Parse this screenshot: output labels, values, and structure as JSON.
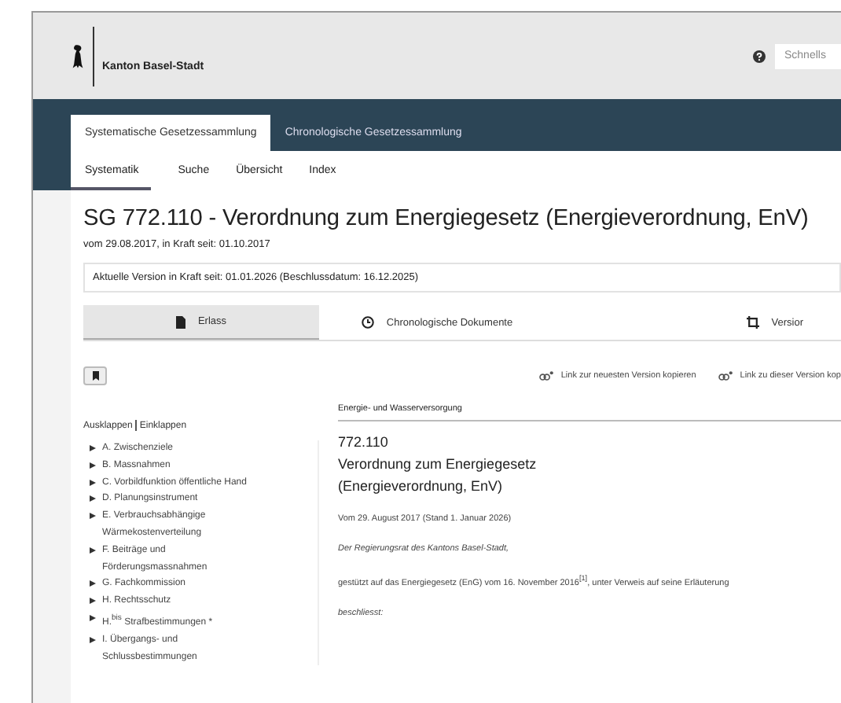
{
  "header": {
    "brand": "Kanton Basel-Stadt",
    "search": {
      "placeholder": "Schnells"
    }
  },
  "nav": {
    "tabs": [
      {
        "label": "Systematische Gesetzessammlung",
        "selected": true
      },
      {
        "label": "Chronologische Gesetzessammlung",
        "selected": false
      }
    ],
    "subtabs": [
      {
        "label": "Systematik",
        "selected": true
      },
      {
        "label": "Suche",
        "selected": false
      },
      {
        "label": "Übersicht",
        "selected": false
      },
      {
        "label": "Index",
        "selected": false
      }
    ]
  },
  "document": {
    "title": "SG 772.110 - Verordnung zum Energiegesetz (Energieverordnung, EnV)",
    "subtitle": "vom 29.08.2017, in Kraft seit: 01.10.2017",
    "version_info": "Aktuelle Version in Kraft seit: 01.01.2026 (Beschlussdatum: 16.12.2025)",
    "view_tabs": [
      {
        "label": "Erlass",
        "kind": "document",
        "selected": true
      },
      {
        "label": "Chronologische Dokumente",
        "kind": "clock",
        "selected": false
      },
      {
        "label": "Versior",
        "kind": "crop",
        "selected": false
      }
    ]
  },
  "links": [
    "Link zur neuesten Version kopieren",
    "Link zu dieser Version kop"
  ],
  "sidebar": {
    "toggle": [
      "Ausklappen",
      "Einklappen"
    ],
    "items": [
      {
        "label": "A. Zwischenziele",
        "expanded": false
      },
      {
        "label": "B. Massnahmen",
        "expanded": false
      },
      {
        "label": "C. Vorbildfunktion öffentliche Hand",
        "expanded": false
      },
      {
        "label": "D. Planungsinstrument",
        "expanded": false
      },
      {
        "label": "E. Verbrauchsabhängige Wärmekostenverteilung",
        "expanded": false
      },
      {
        "label": "F. Beiträge und Förderungsmassnahmen",
        "expanded": false
      },
      {
        "label": "G. Fachkommission",
        "expanded": false
      },
      {
        "label": "H. Rechtsschutz",
        "expanded": false
      },
      {
        "label": "H.$^{bis}$ Strafbestimmungen *",
        "expanded": false
      },
      {
        "label": "I. Übergangs- und Schlussbestimmungen",
        "expanded": false
      }
    ]
  },
  "content": {
    "category": "Energie- und Wasserversorgung",
    "number": "772.110",
    "title_lines": [
      "Verordnung zum Energiegesetz",
      "(Energieverordnung, EnV)"
    ],
    "paragraphs": [
      {
        "text": "Vom 29. August 2017 (Stand 1. Januar 2026)",
        "kind": "plain"
      },
      {
        "text": "Der Regierungsrat des Kantons Basel-Stadt,",
        "kind": "italic"
      },
      {
        "text": "gestützt auf das Energiegesetz (EnG) vom 16. November 2016$^{[1]}$, unter Verweis auf seine Erläuterung",
        "kind": "plain"
      },
      {
        "text": "beschliesst:",
        "kind": "italic"
      }
    ]
  }
}
